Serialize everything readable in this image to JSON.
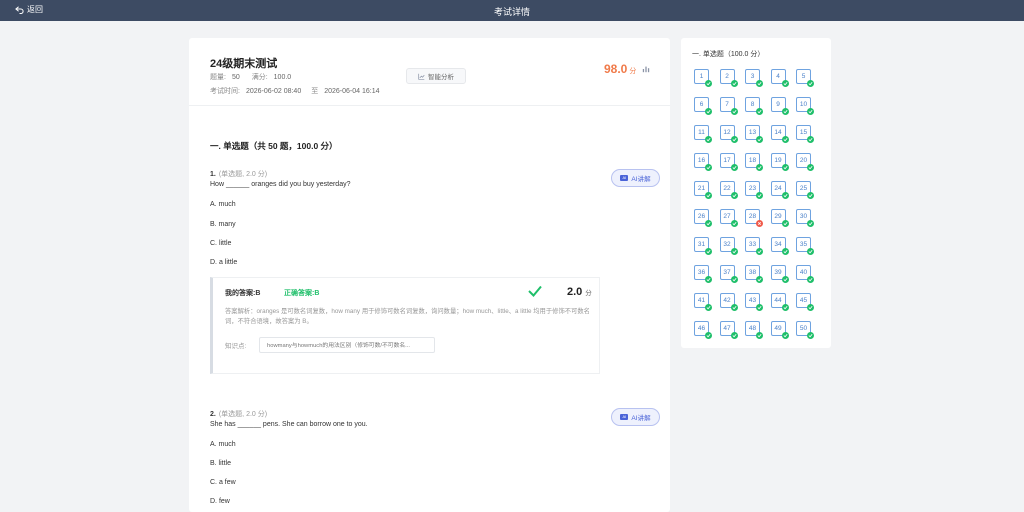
{
  "topbar": {
    "back_label": "返回",
    "title": "考试详情"
  },
  "exam": {
    "title": "24级期末测试",
    "count_label": "题量:",
    "count_value": "50",
    "full_label": "满分:",
    "full_value": "100.0",
    "time_label": "考试时间:",
    "time_start": "2026-06-02 08:40",
    "time_to": "至",
    "time_end": "2026-06-04 16:14",
    "analysis_label": "智能分析",
    "score": "98.0",
    "score_unit": "分"
  },
  "section": {
    "title": "一. 单选题（共 50 题，100.0 分）"
  },
  "questions": [
    {
      "num": "1.",
      "type": "(单选题, 2.0 分)",
      "stem": "How ______ oranges did you buy yesterday?",
      "options": [
        "A. much",
        "B. many",
        "C. little",
        "D. a little"
      ],
      "ai_label": "AI讲解",
      "my_answer": "我的答案:B",
      "correct_answer": "正确答案:B",
      "got": "2.0",
      "got_unit": "分",
      "explanation": "答案解析：oranges 是可数名词复数，how many 用于修饰可数名词复数，询问数量；how much、little、a little 均用于修饰不可数名词，不符合语境，故答案为 B。",
      "kp_label": "知识点:",
      "kp_tag": "howmany与howmuch的用法区别（修饰可数/不可数名..."
    },
    {
      "num": "2.",
      "type": "(单选题, 2.0 分)",
      "stem": "She has ______ pens. She can borrow one to you.",
      "options": [
        "A. much",
        "B. little",
        "C. a few",
        "D. few"
      ],
      "ai_label": "AI讲解"
    }
  ],
  "sidebar": {
    "title": "一. 单选题（100.0 分）",
    "items": [
      {
        "n": "1",
        "s": "correct"
      },
      {
        "n": "2",
        "s": "correct"
      },
      {
        "n": "3",
        "s": "correct"
      },
      {
        "n": "4",
        "s": "correct"
      },
      {
        "n": "5",
        "s": "correct"
      },
      {
        "n": "6",
        "s": "correct"
      },
      {
        "n": "7",
        "s": "correct"
      },
      {
        "n": "8",
        "s": "correct"
      },
      {
        "n": "9",
        "s": "correct"
      },
      {
        "n": "10",
        "s": "correct"
      },
      {
        "n": "11",
        "s": "correct"
      },
      {
        "n": "12",
        "s": "correct"
      },
      {
        "n": "13",
        "s": "correct"
      },
      {
        "n": "14",
        "s": "correct"
      },
      {
        "n": "15",
        "s": "correct"
      },
      {
        "n": "16",
        "s": "correct"
      },
      {
        "n": "17",
        "s": "correct"
      },
      {
        "n": "18",
        "s": "correct"
      },
      {
        "n": "19",
        "s": "correct"
      },
      {
        "n": "20",
        "s": "correct"
      },
      {
        "n": "21",
        "s": "correct"
      },
      {
        "n": "22",
        "s": "correct"
      },
      {
        "n": "23",
        "s": "correct"
      },
      {
        "n": "24",
        "s": "correct"
      },
      {
        "n": "25",
        "s": "correct"
      },
      {
        "n": "26",
        "s": "correct"
      },
      {
        "n": "27",
        "s": "correct"
      },
      {
        "n": "28",
        "s": "wrong"
      },
      {
        "n": "29",
        "s": "correct"
      },
      {
        "n": "30",
        "s": "correct"
      },
      {
        "n": "31",
        "s": "correct"
      },
      {
        "n": "32",
        "s": "correct"
      },
      {
        "n": "33",
        "s": "correct"
      },
      {
        "n": "34",
        "s": "correct"
      },
      {
        "n": "35",
        "s": "correct"
      },
      {
        "n": "36",
        "s": "correct"
      },
      {
        "n": "37",
        "s": "correct"
      },
      {
        "n": "38",
        "s": "correct"
      },
      {
        "n": "39",
        "s": "correct"
      },
      {
        "n": "40",
        "s": "correct"
      },
      {
        "n": "41",
        "s": "correct"
      },
      {
        "n": "42",
        "s": "correct"
      },
      {
        "n": "43",
        "s": "correct"
      },
      {
        "n": "44",
        "s": "correct"
      },
      {
        "n": "45",
        "s": "correct"
      },
      {
        "n": "46",
        "s": "correct"
      },
      {
        "n": "47",
        "s": "correct"
      },
      {
        "n": "48",
        "s": "correct"
      },
      {
        "n": "49",
        "s": "correct"
      },
      {
        "n": "50",
        "s": "correct"
      }
    ]
  },
  "colors": {
    "topbar": "#3d4b63",
    "correct": "#1fbf6a",
    "wrong": "#f05a4a",
    "score": "#f07a49",
    "accent": "#4a63d8"
  },
  "icons": {
    "back": "back-arrow-icon",
    "analysis": "chart-line-icon",
    "stats": "bar-chart-icon",
    "ai": "ai-icon",
    "check": "check-icon",
    "cross": "cross-icon"
  }
}
